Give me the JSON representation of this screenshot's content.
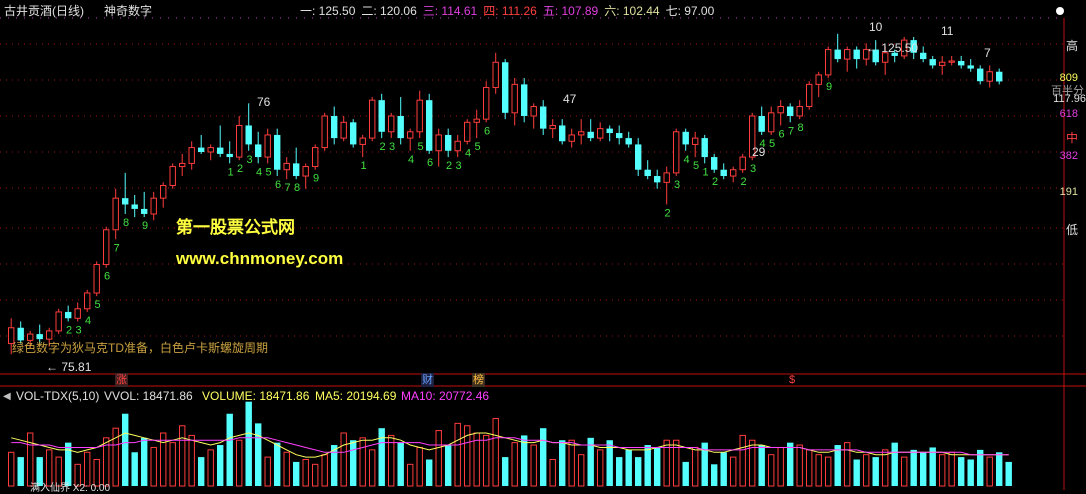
{
  "header": {
    "stock_title": "古井贡酒(日线)",
    "indicator_name": "神奇数字",
    "levels": [
      {
        "label": "一:",
        "value": "125.50",
        "color": "#e0e0e0"
      },
      {
        "label": "二:",
        "value": "120.06",
        "color": "#e0e0e0"
      },
      {
        "label": "三:",
        "value": "114.61",
        "color": "#e040e0"
      },
      {
        "label": "四:",
        "value": "111.26",
        "color": "#ff4040"
      },
      {
        "label": "五:",
        "value": "107.89",
        "color": "#e040e0"
      },
      {
        "label": "六:",
        "value": "102.44",
        "color": "#e0e0a0"
      },
      {
        "label": "七:",
        "value": "97.00",
        "color": "#e0e0e0"
      }
    ]
  },
  "right_axis": {
    "high": "高",
    "v809": "809",
    "half": "百半分",
    "price": "117.96",
    "v618": "618",
    "mid": "中",
    "v382": "382",
    "v191": "191",
    "low": "低"
  },
  "price_labels": {
    "peak": "125.50",
    "bottom": "75.81"
  },
  "counts_top": [
    "76",
    "47",
    "29",
    "10",
    "11",
    "7"
  ],
  "watermark": {
    "line1": "第一股票公式网",
    "line2": "www.chnmoney.com"
  },
  "legend_note": "绿色数字为狄马克TD准备，白色卢卡斯螺旋周期",
  "event_marks": [
    "涨",
    "财",
    "榜",
    "$"
  ],
  "volume_panel": {
    "indicator": "VOL-TDX(5,10)",
    "vvol": "VVOL: 18471.86",
    "volume": "VOLUME: 18471.86",
    "ma5": "MA5: 20194.69",
    "ma10": "MA10: 20772.46",
    "bottom_text": "满入仙界 X2: 0.00"
  },
  "colors": {
    "up": "#ff3c3c",
    "down": "#54ffff",
    "green_count": "#40e040",
    "ma5": "#ffff60",
    "ma10": "#ff40ff",
    "grid": "#a01010"
  },
  "chart_data": {
    "type": "candlestick",
    "price_range": [
      72,
      128
    ],
    "candles": [
      {
        "o": 76.5,
        "h": 80.5,
        "l": 74.8,
        "c": 79.0
      },
      {
        "o": 79.0,
        "h": 80.0,
        "l": 76.5,
        "c": 77.0
      },
      {
        "o": 77.0,
        "h": 78.5,
        "l": 75.8,
        "c": 78.0
      },
      {
        "o": 78.0,
        "h": 79.5,
        "l": 76.5,
        "c": 77.2
      },
      {
        "o": 77.2,
        "h": 79.0,
        "l": 76.0,
        "c": 78.5
      },
      {
        "o": 78.5,
        "h": 82.0,
        "l": 78.0,
        "c": 81.5
      },
      {
        "o": 81.5,
        "h": 82.5,
        "l": 80.0,
        "c": 80.5
      },
      {
        "o": 80.5,
        "h": 83.0,
        "l": 80.0,
        "c": 82.0
      },
      {
        "o": 82.0,
        "h": 85.0,
        "l": 81.5,
        "c": 84.5
      },
      {
        "o": 84.5,
        "h": 89.5,
        "l": 84.0,
        "c": 89.0
      },
      {
        "o": 89.0,
        "h": 95.0,
        "l": 88.5,
        "c": 94.5
      },
      {
        "o": 94.5,
        "h": 101.0,
        "l": 93.0,
        "c": 99.5
      },
      {
        "o": 99.5,
        "h": 103.5,
        "l": 97.0,
        "c": 98.5
      },
      {
        "o": 98.5,
        "h": 100.0,
        "l": 96.5,
        "c": 97.8
      },
      {
        "o": 97.8,
        "h": 100.5,
        "l": 96.5,
        "c": 97.0
      },
      {
        "o": 97.0,
        "h": 100.5,
        "l": 96.0,
        "c": 99.5
      },
      {
        "o": 99.5,
        "h": 102.0,
        "l": 98.0,
        "c": 101.5
      },
      {
        "o": 101.5,
        "h": 105.0,
        "l": 101.0,
        "c": 104.5
      },
      {
        "o": 104.5,
        "h": 106.5,
        "l": 103.0,
        "c": 105.0
      },
      {
        "o": 105.0,
        "h": 108.5,
        "l": 104.0,
        "c": 107.5
      },
      {
        "o": 107.5,
        "h": 109.5,
        "l": 106.5,
        "c": 106.8
      },
      {
        "o": 106.8,
        "h": 108.0,
        "l": 105.5,
        "c": 107.5
      },
      {
        "o": 107.5,
        "h": 111.0,
        "l": 106.0,
        "c": 106.5
      },
      {
        "o": 106.5,
        "h": 108.5,
        "l": 105.0,
        "c": 106.0
      },
      {
        "o": 106.0,
        "h": 112.5,
        "l": 105.5,
        "c": 111.0
      },
      {
        "o": 111.0,
        "h": 114.5,
        "l": 107.0,
        "c": 108.0
      },
      {
        "o": 108.0,
        "h": 110.0,
        "l": 105.0,
        "c": 106.0
      },
      {
        "o": 106.0,
        "h": 110.5,
        "l": 105.0,
        "c": 109.5
      },
      {
        "o": 109.5,
        "h": 110.5,
        "l": 103.0,
        "c": 104.0
      },
      {
        "o": 104.0,
        "h": 106.0,
        "l": 102.5,
        "c": 105.0
      },
      {
        "o": 105.0,
        "h": 107.5,
        "l": 102.5,
        "c": 103.0
      },
      {
        "o": 103.0,
        "h": 105.0,
        "l": 101.0,
        "c": 104.5
      },
      {
        "o": 104.5,
        "h": 108.0,
        "l": 104.0,
        "c": 107.5
      },
      {
        "o": 107.5,
        "h": 113.0,
        "l": 107.0,
        "c": 112.5
      },
      {
        "o": 112.5,
        "h": 114.0,
        "l": 108.0,
        "c": 109.0
      },
      {
        "o": 109.0,
        "h": 112.5,
        "l": 108.5,
        "c": 111.5
      },
      {
        "o": 111.5,
        "h": 112.0,
        "l": 107.5,
        "c": 108.0
      },
      {
        "o": 108.0,
        "h": 109.5,
        "l": 106.0,
        "c": 109.0
      },
      {
        "o": 109.0,
        "h": 115.5,
        "l": 108.5,
        "c": 115.0
      },
      {
        "o": 115.0,
        "h": 116.0,
        "l": 109.0,
        "c": 110.0
      },
      {
        "o": 110.0,
        "h": 113.0,
        "l": 109.0,
        "c": 112.5
      },
      {
        "o": 112.5,
        "h": 115.5,
        "l": 108.0,
        "c": 109.0
      },
      {
        "o": 109.0,
        "h": 110.5,
        "l": 107.0,
        "c": 110.0
      },
      {
        "o": 110.0,
        "h": 116.5,
        "l": 109.0,
        "c": 115.0
      },
      {
        "o": 115.0,
        "h": 116.0,
        "l": 106.5,
        "c": 107.0
      },
      {
        "o": 107.0,
        "h": 110.5,
        "l": 104.5,
        "c": 109.5
      },
      {
        "o": 109.5,
        "h": 110.5,
        "l": 106.0,
        "c": 107.0
      },
      {
        "o": 107.0,
        "h": 109.5,
        "l": 106.0,
        "c": 108.5
      },
      {
        "o": 108.5,
        "h": 112.0,
        "l": 108.0,
        "c": 111.5
      },
      {
        "o": 111.5,
        "h": 113.5,
        "l": 109.0,
        "c": 112.0
      },
      {
        "o": 112.0,
        "h": 118.0,
        "l": 111.5,
        "c": 117.0
      },
      {
        "o": 117.0,
        "h": 122.5,
        "l": 116.0,
        "c": 121.0
      },
      {
        "o": 121.0,
        "h": 121.5,
        "l": 112.0,
        "c": 113.0
      },
      {
        "o": 113.0,
        "h": 118.5,
        "l": 111.0,
        "c": 117.5
      },
      {
        "o": 117.5,
        "h": 118.5,
        "l": 111.5,
        "c": 112.5
      },
      {
        "o": 112.5,
        "h": 114.5,
        "l": 110.5,
        "c": 114.0
      },
      {
        "o": 114.0,
        "h": 115.0,
        "l": 109.5,
        "c": 110.5
      },
      {
        "o": 110.5,
        "h": 112.0,
        "l": 109.0,
        "c": 111.0
      },
      {
        "o": 111.0,
        "h": 112.0,
        "l": 108.0,
        "c": 108.5
      },
      {
        "o": 108.5,
        "h": 110.5,
        "l": 107.5,
        "c": 109.5
      },
      {
        "o": 109.5,
        "h": 112.0,
        "l": 108.0,
        "c": 110.0
      },
      {
        "o": 110.0,
        "h": 112.0,
        "l": 108.5,
        "c": 109.0
      },
      {
        "o": 109.0,
        "h": 111.5,
        "l": 108.5,
        "c": 110.5
      },
      {
        "o": 110.5,
        "h": 111.0,
        "l": 108.5,
        "c": 109.8
      },
      {
        "o": 109.8,
        "h": 111.0,
        "l": 108.0,
        "c": 109.0
      },
      {
        "o": 109.0,
        "h": 110.0,
        "l": 107.5,
        "c": 108.0
      },
      {
        "o": 108.0,
        "h": 109.0,
        "l": 103.0,
        "c": 104.0
      },
      {
        "o": 104.0,
        "h": 105.5,
        "l": 102.5,
        "c": 103.0
      },
      {
        "o": 103.0,
        "h": 104.0,
        "l": 101.0,
        "c": 102.0
      },
      {
        "o": 102.0,
        "h": 104.5,
        "l": 98.5,
        "c": 103.5
      },
      {
        "o": 103.5,
        "h": 110.5,
        "l": 103.0,
        "c": 110.0
      },
      {
        "o": 110.0,
        "h": 110.5,
        "l": 107.0,
        "c": 108.0
      },
      {
        "o": 108.0,
        "h": 110.0,
        "l": 106.0,
        "c": 109.0
      },
      {
        "o": 109.0,
        "h": 109.5,
        "l": 105.0,
        "c": 106.0
      },
      {
        "o": 106.0,
        "h": 106.5,
        "l": 103.5,
        "c": 104.0
      },
      {
        "o": 104.0,
        "h": 105.0,
        "l": 102.5,
        "c": 103.0
      },
      {
        "o": 103.0,
        "h": 104.5,
        "l": 102.0,
        "c": 104.0
      },
      {
        "o": 104.0,
        "h": 106.5,
        "l": 103.5,
        "c": 106.0
      },
      {
        "o": 106.0,
        "h": 113.0,
        "l": 105.5,
        "c": 112.5
      },
      {
        "o": 112.5,
        "h": 114.0,
        "l": 109.5,
        "c": 110.0
      },
      {
        "o": 110.0,
        "h": 114.0,
        "l": 109.5,
        "c": 113.0
      },
      {
        "o": 113.0,
        "h": 115.0,
        "l": 111.0,
        "c": 114.0
      },
      {
        "o": 114.0,
        "h": 114.5,
        "l": 111.5,
        "c": 112.5
      },
      {
        "o": 112.5,
        "h": 115.0,
        "l": 112.0,
        "c": 114.0
      },
      {
        "o": 114.0,
        "h": 118.0,
        "l": 113.5,
        "c": 117.5
      },
      {
        "o": 117.5,
        "h": 119.5,
        "l": 115.5,
        "c": 119.0
      },
      {
        "o": 119.0,
        "h": 123.5,
        "l": 118.5,
        "c": 123.0
      },
      {
        "o": 123.0,
        "h": 125.5,
        "l": 121.0,
        "c": 121.5
      },
      {
        "o": 121.5,
        "h": 123.5,
        "l": 119.5,
        "c": 123.0
      },
      {
        "o": 123.0,
        "h": 123.5,
        "l": 120.0,
        "c": 121.5
      },
      {
        "o": 121.5,
        "h": 124.0,
        "l": 120.5,
        "c": 123.0
      },
      {
        "o": 123.0,
        "h": 124.5,
        "l": 120.5,
        "c": 121.0
      },
      {
        "o": 121.0,
        "h": 123.5,
        "l": 119.0,
        "c": 122.5
      },
      {
        "o": 122.5,
        "h": 123.0,
        "l": 121.0,
        "c": 122.0
      },
      {
        "o": 122.0,
        "h": 125.0,
        "l": 121.5,
        "c": 124.5
      },
      {
        "o": 124.5,
        "h": 125.0,
        "l": 121.5,
        "c": 122.5
      },
      {
        "o": 122.5,
        "h": 123.5,
        "l": 121.0,
        "c": 121.5
      },
      {
        "o": 121.5,
        "h": 122.0,
        "l": 120.0,
        "c": 120.5
      },
      {
        "o": 120.5,
        "h": 122.0,
        "l": 119.0,
        "c": 121.0
      },
      {
        "o": 121.0,
        "h": 122.0,
        "l": 120.5,
        "c": 121.2
      },
      {
        "o": 121.2,
        "h": 122.0,
        "l": 120.0,
        "c": 120.5
      },
      {
        "o": 120.5,
        "h": 121.5,
        "l": 119.5,
        "c": 120.0
      },
      {
        "o": 120.0,
        "h": 120.5,
        "l": 117.5,
        "c": 118.0
      },
      {
        "o": 118.0,
        "h": 120.5,
        "l": 117.0,
        "c": 119.5
      },
      {
        "o": 119.5,
        "h": 120.0,
        "l": 117.5,
        "c": 117.96
      }
    ],
    "volume": [
      14,
      12,
      22,
      12,
      15,
      12,
      18,
      9,
      14,
      11,
      20,
      24,
      30,
      14,
      20,
      16,
      22,
      18,
      25,
      21,
      12,
      15,
      17,
      30,
      19,
      35,
      26,
      12,
      18,
      14,
      10,
      11,
      9,
      13,
      17,
      22,
      19,
      20,
      15,
      24,
      21,
      18,
      9,
      16,
      11,
      23,
      17,
      26,
      25,
      22,
      21,
      28,
      12,
      18,
      21,
      17,
      24,
      11,
      19,
      19,
      13,
      20,
      15,
      19,
      12,
      15,
      12,
      17,
      16,
      19,
      19,
      10,
      16,
      18,
      9,
      14,
      12,
      21,
      19,
      17,
      13,
      16,
      18,
      17,
      15,
      13,
      12,
      17,
      18,
      11,
      13,
      12,
      15,
      18,
      12,
      15,
      14,
      16,
      13,
      14,
      12,
      11,
      15,
      12,
      14,
      10
    ],
    "ma5": [
      20,
      19,
      18,
      17,
      16,
      15,
      15,
      14,
      15,
      16,
      18,
      20,
      22,
      21,
      20,
      19,
      18,
      19,
      20,
      19,
      18,
      17,
      18,
      20,
      21,
      22,
      21,
      19,
      17,
      15,
      13,
      12,
      12,
      13,
      15,
      17,
      18,
      19,
      19,
      20,
      20,
      19,
      17,
      16,
      15,
      16,
      17,
      19,
      21,
      22,
      22,
      21,
      20,
      19,
      18,
      18,
      19,
      18,
      18,
      17,
      17,
      17,
      16,
      16,
      16,
      15,
      15,
      15,
      16,
      17,
      17,
      16,
      15,
      15,
      14,
      14,
      15,
      16,
      17,
      17,
      16,
      16,
      16,
      16,
      15,
      14,
      14,
      15,
      15,
      14,
      14,
      13,
      13,
      14,
      14,
      14,
      14,
      14,
      14,
      13,
      13,
      13,
      13,
      13,
      13,
      13
    ],
    "ma10": [
      18,
      18,
      17,
      17,
      17,
      16,
      16,
      16,
      16,
      16,
      17,
      17,
      18,
      18,
      19,
      19,
      19,
      19,
      19,
      19,
      19,
      19,
      19,
      19,
      20,
      20,
      20,
      20,
      19,
      18,
      17,
      16,
      15,
      14,
      14,
      14,
      15,
      16,
      17,
      18,
      18,
      18,
      18,
      18,
      17,
      17,
      17,
      17,
      18,
      19,
      19,
      20,
      20,
      20,
      19,
      19,
      19,
      18,
      18,
      18,
      17,
      17,
      17,
      17,
      16,
      16,
      16,
      16,
      16,
      16,
      16,
      16,
      16,
      15,
      15,
      15,
      15,
      15,
      16,
      16,
      16,
      16,
      16,
      16,
      15,
      15,
      15,
      15,
      15,
      15,
      14,
      14,
      14,
      14,
      14,
      14,
      14,
      14,
      14,
      14,
      14,
      13,
      13,
      13,
      13,
      13
    ],
    "td_counts": [
      {
        "i": 6,
        "n": "2"
      },
      {
        "i": 7,
        "n": "3"
      },
      {
        "i": 8,
        "n": "4"
      },
      {
        "i": 9,
        "n": "5"
      },
      {
        "i": 10,
        "n": "6"
      },
      {
        "i": 11,
        "n": "7"
      },
      {
        "i": 12,
        "n": "8"
      },
      {
        "i": 14,
        "n": "9"
      },
      {
        "i": 23,
        "n": "1"
      },
      {
        "i": 24,
        "n": "2"
      },
      {
        "i": 25,
        "n": "3"
      },
      {
        "i": 26,
        "n": "4"
      },
      {
        "i": 27,
        "n": "5"
      },
      {
        "i": 28,
        "n": "6"
      },
      {
        "i": 29,
        "n": "7"
      },
      {
        "i": 30,
        "n": "8"
      },
      {
        "i": 32,
        "n": "9"
      },
      {
        "i": 37,
        "n": "1"
      },
      {
        "i": 39,
        "n": "2"
      },
      {
        "i": 40,
        "n": "3"
      },
      {
        "i": 42,
        "n": "4"
      },
      {
        "i": 43,
        "n": "5"
      },
      {
        "i": 44,
        "n": "6"
      },
      {
        "i": 46,
        "n": "2"
      },
      {
        "i": 47,
        "n": "3"
      },
      {
        "i": 48,
        "n": "4"
      },
      {
        "i": 49,
        "n": "5"
      },
      {
        "i": 50,
        "n": "6"
      },
      {
        "i": 69,
        "n": "2"
      },
      {
        "i": 70,
        "n": "3"
      },
      {
        "i": 71,
        "n": "4"
      },
      {
        "i": 72,
        "n": "5"
      },
      {
        "i": 73,
        "n": "1"
      },
      {
        "i": 74,
        "n": "2"
      },
      {
        "i": 77,
        "n": "2"
      },
      {
        "i": 78,
        "n": "3"
      },
      {
        "i": 79,
        "n": "4"
      },
      {
        "i": 80,
        "n": "5"
      },
      {
        "i": 81,
        "n": "6"
      },
      {
        "i": 82,
        "n": "7"
      },
      {
        "i": 83,
        "n": "8"
      },
      {
        "i": 86,
        "n": "9"
      }
    ]
  }
}
